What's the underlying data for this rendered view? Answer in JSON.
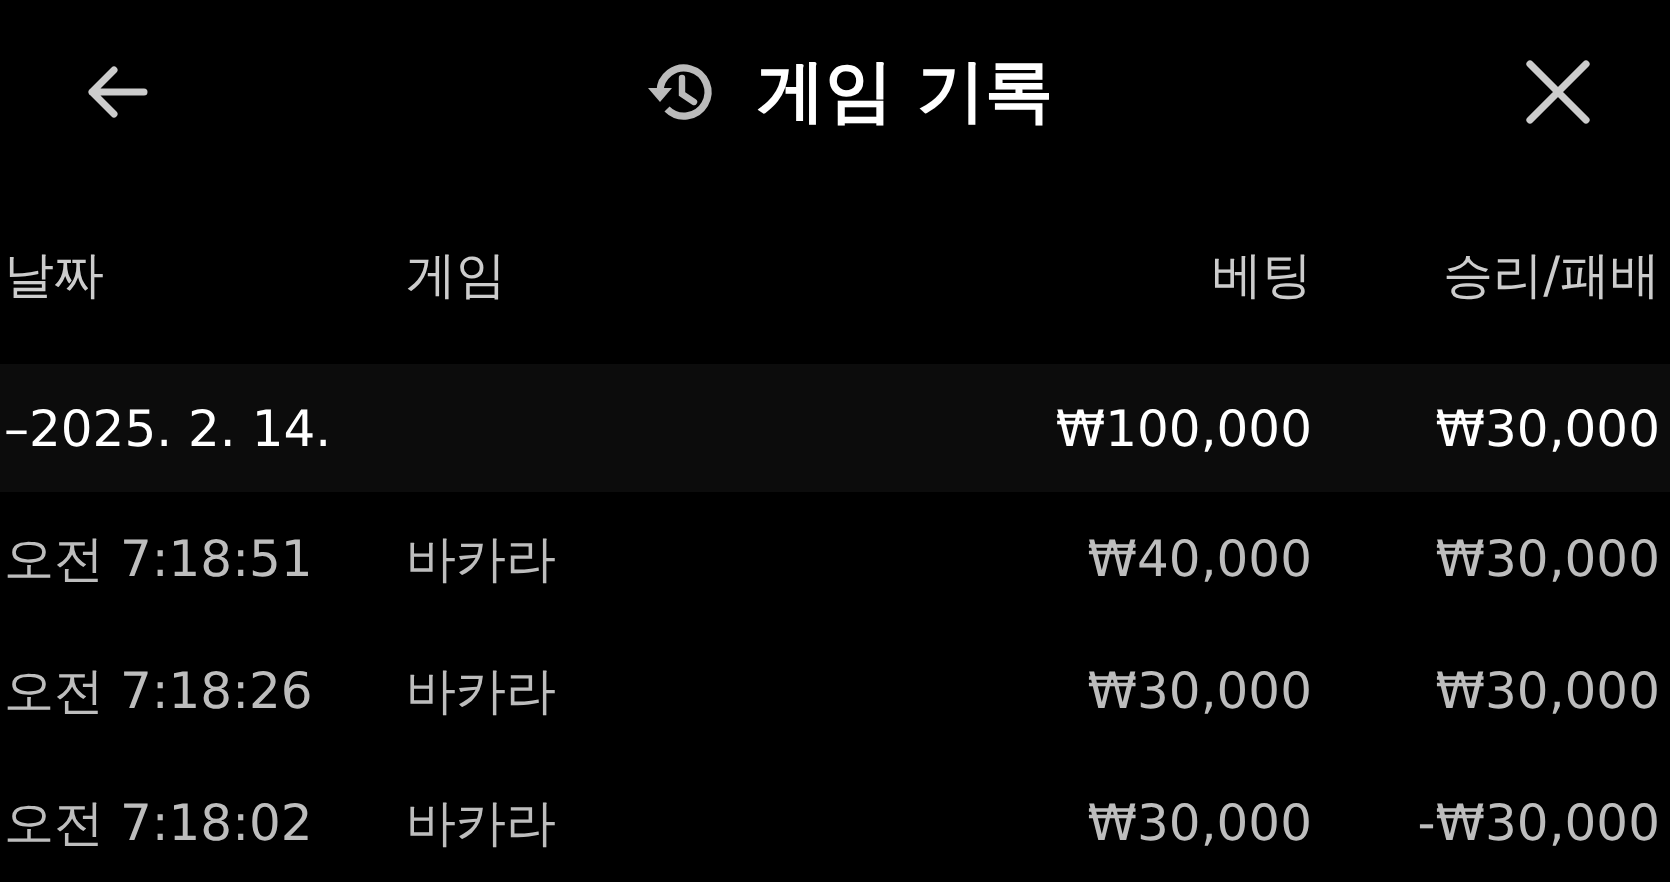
{
  "header": {
    "title": "게임 기록"
  },
  "table": {
    "columns": [
      "날짜",
      "게임",
      "베팅",
      "승리/패배"
    ],
    "group": {
      "date": "–2025. 2. 14.",
      "bet": "₩100,000",
      "result": "₩30,000"
    },
    "rows": [
      {
        "time": "오전 7:18:51",
        "game": "바카라",
        "bet": "₩40,000",
        "result": "₩30,000"
      },
      {
        "time": "오전 7:18:26",
        "game": "바카라",
        "bet": "₩30,000",
        "result": "₩30,000"
      },
      {
        "time": "오전 7:18:02",
        "game": "바카라",
        "bet": "₩30,000",
        "result": "-₩30,000"
      }
    ]
  }
}
